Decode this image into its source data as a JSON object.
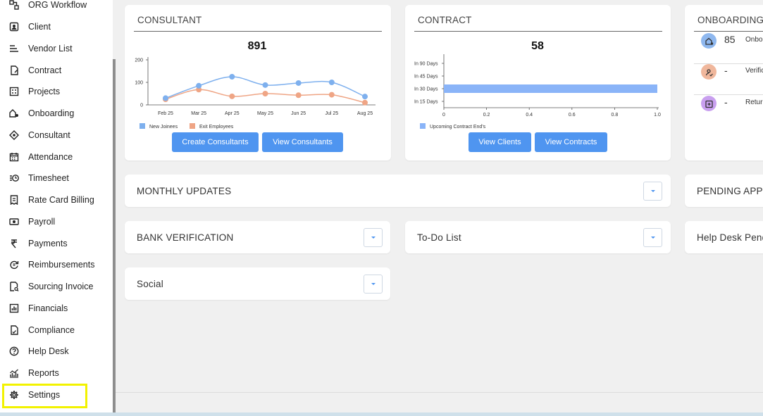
{
  "sidebar": {
    "items": [
      {
        "label": "ORG Workflow",
        "icon": "workflow-icon"
      },
      {
        "label": "Client",
        "icon": "client-icon"
      },
      {
        "label": "Vendor List",
        "icon": "vendor-list-icon"
      },
      {
        "label": "Contract",
        "icon": "contract-icon"
      },
      {
        "label": "Projects",
        "icon": "projects-icon"
      },
      {
        "label": "Onboarding",
        "icon": "onboarding-icon"
      },
      {
        "label": "Consultant",
        "icon": "consultant-icon"
      },
      {
        "label": "Attendance",
        "icon": "calendar-icon"
      },
      {
        "label": "Timesheet",
        "icon": "timesheet-icon"
      },
      {
        "label": "Rate Card Billing",
        "icon": "billing-icon"
      },
      {
        "label": "Payroll",
        "icon": "payroll-icon"
      },
      {
        "label": "Payments",
        "icon": "rupee-icon"
      },
      {
        "label": "Reimbursements",
        "icon": "reimbursement-icon"
      },
      {
        "label": "Sourcing Invoice",
        "icon": "invoice-icon"
      },
      {
        "label": "Financials",
        "icon": "financials-icon"
      },
      {
        "label": "Compliance",
        "icon": "compliance-icon"
      },
      {
        "label": "Help Desk",
        "icon": "help-icon"
      },
      {
        "label": "Reports",
        "icon": "reports-icon"
      },
      {
        "label": "Settings",
        "icon": "gear-icon"
      }
    ],
    "highlighted": "Settings",
    "highlight_color": "#f2f200"
  },
  "consultant": {
    "title": "CONSULTANT",
    "total": "891",
    "create_label": "Create Consultants",
    "view_label": "View Consultants"
  },
  "contract": {
    "title": "CONTRACT",
    "total": "58",
    "view_clients_label": "View Clients",
    "view_contracts_label": "View Contracts"
  },
  "onboarding": {
    "title": "ONBOARDING",
    "rows": [
      {
        "value": "85",
        "label": "Onbo",
        "icon": "onboarding-icon",
        "color": "#8fb8ef"
      },
      {
        "value": "-",
        "label": "Verifica",
        "icon": "verification-icon",
        "color": "#f0b79c"
      },
      {
        "value": "-",
        "label": "Returne",
        "icon": "return-icon",
        "color": "#c9a0ef"
      }
    ]
  },
  "panels": {
    "monthly_updates": "MONTHLY UPDATES",
    "pending": "PENDING APPR",
    "bank_verification": "BANK VERIFICATION",
    "todo": "To-Do List",
    "help_desk": "Help Desk Pend",
    "social": "Social"
  },
  "colors": {
    "accent": "#4f95f0",
    "series_new": "#7eb0ee",
    "series_exit": "#efa585",
    "bar": "#8ab4f8"
  },
  "chart_data": [
    {
      "type": "line",
      "categories": [
        "Feb 25",
        "Mar 25",
        "Apr 25",
        "May 25",
        "Jun 25",
        "Jul 25",
        "Aug 25"
      ],
      "series": [
        {
          "name": "New Joinees",
          "values": [
            30,
            85,
            125,
            88,
            97,
            100,
            37
          ]
        },
        {
          "name": "Exit Employees",
          "values": [
            25,
            68,
            38,
            50,
            43,
            45,
            10
          ]
        }
      ],
      "ylim": [
        0,
        200
      ],
      "yticks": [
        0,
        100,
        200
      ],
      "legend": "bottom-left"
    },
    {
      "type": "bar",
      "orientation": "horizontal",
      "categories": [
        "In 90 Days",
        "In 45 Days",
        "In 30 Days",
        "In 15 Days"
      ],
      "series": [
        {
          "name": "Upcoming Contract End's",
          "values": [
            0,
            0,
            1,
            0
          ]
        }
      ],
      "xlim": [
        0,
        1.0
      ],
      "xticks": [
        "0",
        "0.2",
        "0.4",
        "0.6",
        "0.8",
        "1.0"
      ],
      "legend": "bottom-left"
    }
  ]
}
